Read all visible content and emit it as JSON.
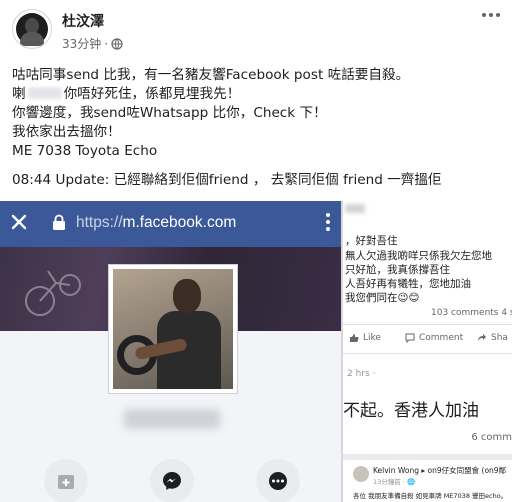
{
  "author": {
    "name": "杜汶澤",
    "time": "33分钟"
  },
  "post_lines": [
    "咕咕同事send 比我，有一名豬友響Facebook post 咗話要自殺。",
    "你唔好死住，係都見埋我先！",
    "你響邊度，我send咗Whatsapp 比你，Check 下！",
    "我依家出去搵你！",
    "ME 7038 Toyota Echo",
    "08:44 Update: 已經聯絡到佢個friend ， 去緊同佢個 friend 一齊搵佢"
  ],
  "post_line2_prefix": "喇",
  "browser": {
    "url_prefix": "https://",
    "url_domain": "m.facebook.com"
  },
  "right_panel": {
    "lines": [
      "，好對吾住",
      "無人欠過我啲咩只係我欠左您地",
      "只好尬，我真係撐吾住",
      "人吾好再有犧牲，您地加油",
      "我您們同在😉😊"
    ],
    "counts": "103 comments  4 sh",
    "like": "Like",
    "comment": "Comment",
    "share": "Sha",
    "time": "2 hrs ·",
    "big_text": "不起。香港人加油",
    "comments_short": "6 comm",
    "commenter": "Kelvin Wong ▸ on9仔女同盟會 (on9鄰",
    "comment_time": "13分鐘前 · 🌐",
    "comment_text": "各位 我朋友準備自殺 如見車牌 ME7038 豐田echo。"
  },
  "colors": {
    "fb_blue": "#3b5998",
    "text": "#1c1e21",
    "meta": "#65676b"
  }
}
